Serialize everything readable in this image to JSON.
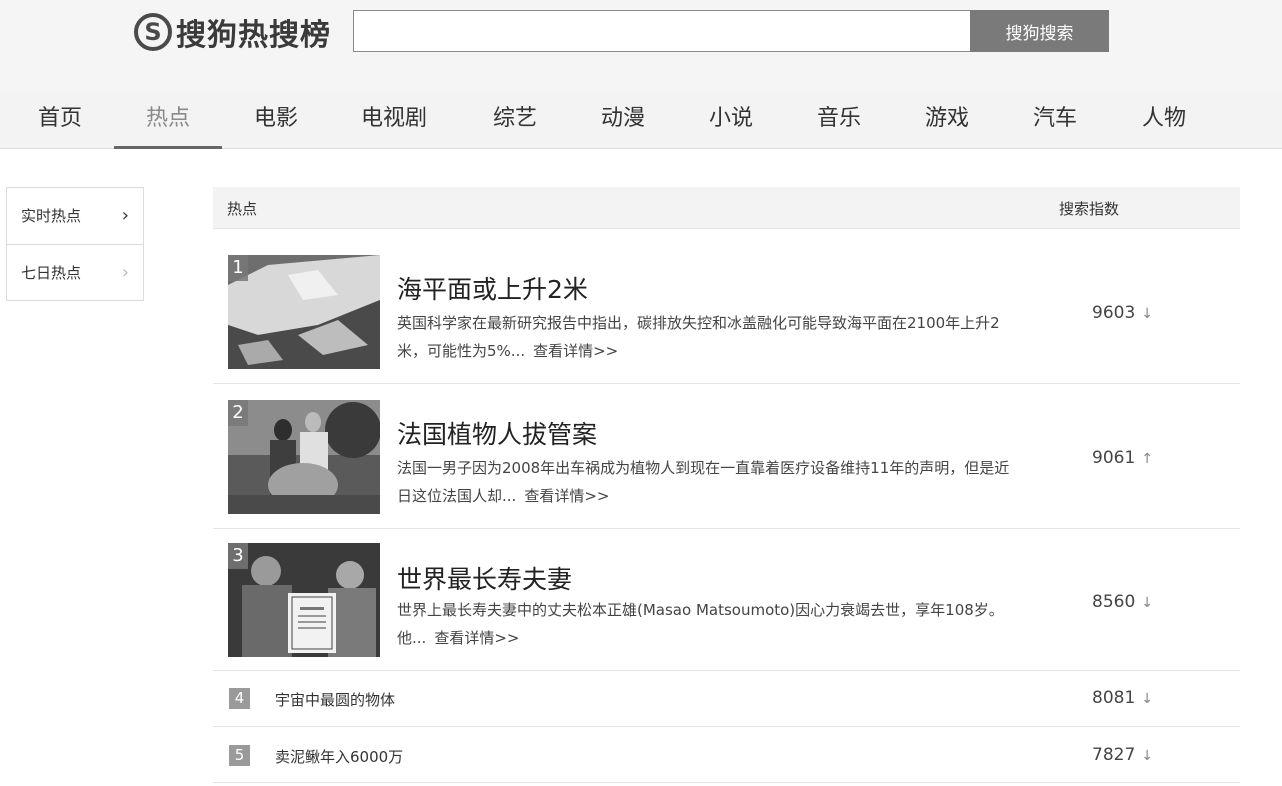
{
  "header": {
    "logo_mark": "S",
    "logo_text": "搜狗热搜榜",
    "search_placeholder": "",
    "search_button": "搜狗搜索"
  },
  "nav": [
    "首页",
    "热点",
    "电影",
    "电视剧",
    "综艺",
    "动漫",
    "小说",
    "音乐",
    "游戏",
    "汽车",
    "人物"
  ],
  "nav_active": "热点",
  "sidebar": [
    {
      "label": "实时热点",
      "chevron": "›"
    },
    {
      "label": "七日热点",
      "chevron": "›"
    }
  ],
  "list": {
    "header_left": "热点",
    "header_right": "搜索指数",
    "featured": [
      {
        "rank": "1",
        "title": "海平面或上升2米",
        "desc": "英国科学家在最新研究报告中指出，碳排放失控和冰盖融化可能导致海平面在2100年上升2米，可能性为5%...",
        "more": "查看详情>>",
        "score": "9603",
        "trend": "↓",
        "thumb_icon": "iceberg-photo"
      },
      {
        "rank": "2",
        "title": "法国植物人拔管案",
        "desc": "法国一男子因为2008年出车祸成为植物人到现在一直靠着医疗设备维持11年的声明，但是近日这位法国人却...",
        "more": "查看详情>>",
        "score": "9061",
        "trend": "↑",
        "thumb_icon": "protest-photo"
      },
      {
        "rank": "3",
        "title": "世界最长寿夫妻",
        "desc": "世界上最长寿夫妻中的丈夫松本正雄(Masao Matsoumoto)因心力衰竭去世，享年108岁。他...",
        "more": "查看详情>>",
        "score": "8560",
        "trend": "↓",
        "thumb_icon": "elderly-couple-photo"
      }
    ],
    "compact": [
      {
        "rank": "4",
        "title": "宇宙中最圆的物体",
        "score": "8081",
        "trend": "↓"
      },
      {
        "rank": "5",
        "title": "卖泥鳅年入6000万",
        "score": "7827",
        "trend": "↓"
      }
    ]
  }
}
